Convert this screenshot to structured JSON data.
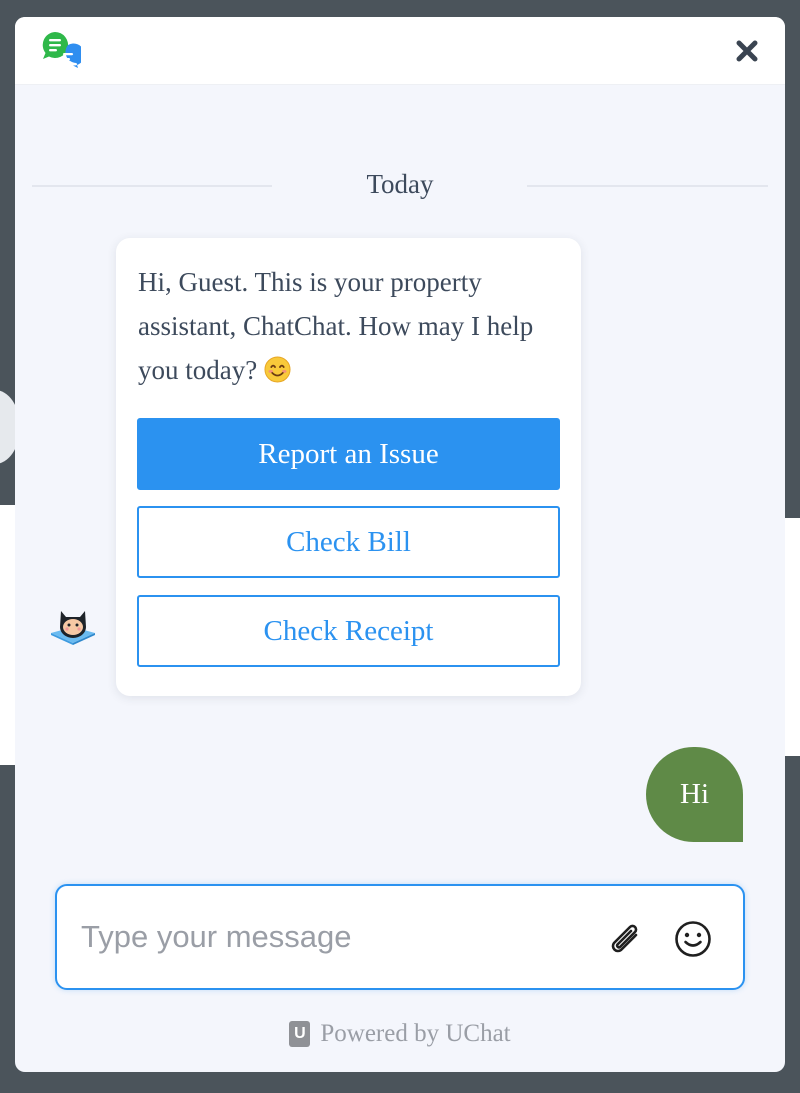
{
  "header": {
    "logo_icon": "chat-bubbles-icon",
    "close_icon": "close-icon"
  },
  "conversation": {
    "date_separator": "Today",
    "bot_message": {
      "text": "Hi, Guest. This is your property assistant, ChatChat. How may I help you today?",
      "emoji": "smiling-face-icon",
      "avatar": "cat-bot-avatar",
      "quick_replies": [
        "Report an Issue",
        "Check Bill",
        "Check Receipt"
      ]
    },
    "user_message": {
      "text": "Hi"
    }
  },
  "composer": {
    "placeholder": "Type your message",
    "value": "",
    "attach_icon": "paperclip-icon",
    "emoji_icon": "smiley-icon"
  },
  "footer": {
    "badge": "U",
    "powered_by": "Powered by UChat"
  },
  "colors": {
    "accent": "#2b92f0",
    "user_bubble": "#5f8a47",
    "panel_bg": "#f4f6fc",
    "page_bg": "#4b545b"
  }
}
